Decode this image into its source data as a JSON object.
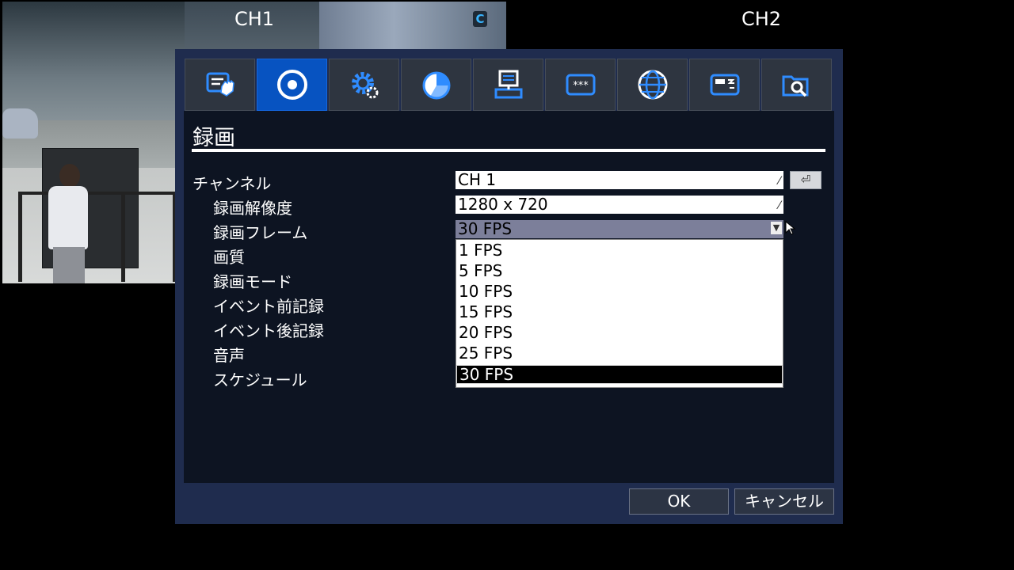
{
  "channels": {
    "ch1_label": "CH1",
    "ch2_label": "CH2",
    "camera_badge": "C"
  },
  "tabs": [
    {
      "icon": "hand-menu-icon",
      "active": false
    },
    {
      "icon": "record-disc-icon",
      "active": true
    },
    {
      "icon": "gear-icon",
      "active": false
    },
    {
      "icon": "pie-chart-icon",
      "active": false
    },
    {
      "icon": "computer-icon",
      "active": false
    },
    {
      "icon": "password-icon",
      "active": false
    },
    {
      "icon": "globe-icon",
      "active": false
    },
    {
      "icon": "storage-icon",
      "active": false
    },
    {
      "icon": "search-folder-icon",
      "active": false
    }
  ],
  "page": {
    "title": "録画"
  },
  "settings": {
    "channel_label": "チャンネル",
    "channel_value": "CH 1",
    "resolution_label": "録画解像度",
    "resolution_value": "1280 x 720",
    "frame_label": "録画フレーム",
    "frame_value": "30 FPS",
    "quality_label": "画質",
    "mode_label": "録画モード",
    "pre_event_label": "イベント前記録",
    "post_event_label": "イベント後記録",
    "audio_label": "音声",
    "schedule_label": "スケジュール",
    "edit_mark": "⁄",
    "enter_symbol": "⏎"
  },
  "frame_options": [
    "1 FPS",
    "5 FPS",
    "10 FPS",
    "15 FPS",
    "20 FPS",
    "25 FPS",
    "30 FPS"
  ],
  "frame_selected_index": 6,
  "buttons": {
    "ok": "OK",
    "cancel": "キャンセル"
  },
  "colors": {
    "dialog_bg": "#1f2c4e",
    "active_tab": "#0753c1",
    "icon_blue": "#2f8cff"
  }
}
